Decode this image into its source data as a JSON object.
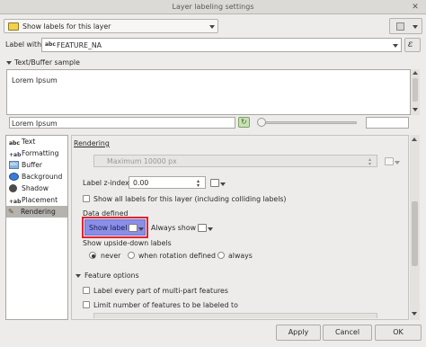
{
  "window": {
    "title": "Layer labeling settings"
  },
  "top": {
    "mode_combo": "Show labels for this layer",
    "label_with": "Label with",
    "field_value": "FEATURE_NA",
    "field_prefix": "abc"
  },
  "sample": {
    "section_title": "Text/Buffer sample",
    "preview_text": "Lorem Ipsum",
    "input_value": "Lorem Ipsum"
  },
  "sidebar": {
    "items": [
      {
        "label": "Text"
      },
      {
        "label": "Formatting"
      },
      {
        "label": "Buffer"
      },
      {
        "label": "Background"
      },
      {
        "label": "Shadow"
      },
      {
        "label": "Placement"
      },
      {
        "label": "Rendering"
      }
    ]
  },
  "rendering": {
    "section_title": "Rendering",
    "max_field": "Maximum 10000 px",
    "zindex_label": "Label z-index",
    "zindex_value": "0.00",
    "show_all_label": "Show all labels for this layer (including colliding labels)",
    "data_defined": "Data defined",
    "show_label": "Show label",
    "always_show": "Always show",
    "upside_down_title": "Show upside-down labels",
    "radio": {
      "never": "never",
      "rotation": "when rotation defined",
      "always": "always"
    },
    "feature_options": "Feature options",
    "label_every_part": "Label every part of multi-part features",
    "limit_number": "Limit number of features to be labeled to"
  },
  "buttons": {
    "apply": "Apply",
    "cancel": "Cancel",
    "ok": "OK"
  },
  "colors": {
    "highlight_border": "#e0242f",
    "highlight_fill": "#8a8ee8"
  }
}
